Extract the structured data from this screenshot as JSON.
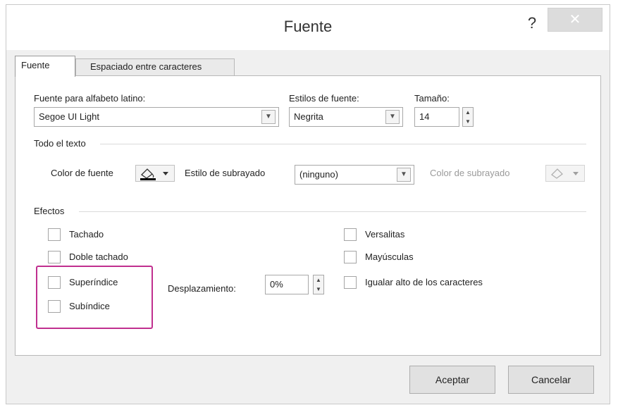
{
  "dialog": {
    "title": "Fuente",
    "help_label": "?",
    "close_label": "✕"
  },
  "tabs": [
    {
      "label": "Fuente"
    },
    {
      "label": "Espaciado entre caracteres"
    }
  ],
  "font_section": {
    "latin_font_label": "Fuente para alfabeto latino:",
    "latin_font_value": "Segoe UI Light",
    "style_label": "Estilos de fuente:",
    "style_value": "Negrita",
    "size_label": "Tamaño:",
    "size_value": "14"
  },
  "all_text": {
    "header": "Todo el texto",
    "font_color_label": "Color de fuente",
    "font_color": "#000000",
    "underline_style_label": "Estilo de subrayado",
    "underline_style_value": "(ninguno)",
    "underline_color_label": "Color de subrayado"
  },
  "effects": {
    "header": "Efectos",
    "strikethrough": "Tachado",
    "double_strikethrough": "Doble tachado",
    "superscript": "Superíndice",
    "subscript": "Subíndice",
    "offset_label": "Desplazamiento:",
    "offset_value": "0%",
    "small_caps": "Versalitas",
    "all_caps": "Mayúsculas",
    "equalize_height": "Igualar alto de los caracteres"
  },
  "buttons": {
    "ok": "Aceptar",
    "cancel": "Cancelar"
  },
  "colors": {
    "highlight": "#c02f8f"
  }
}
